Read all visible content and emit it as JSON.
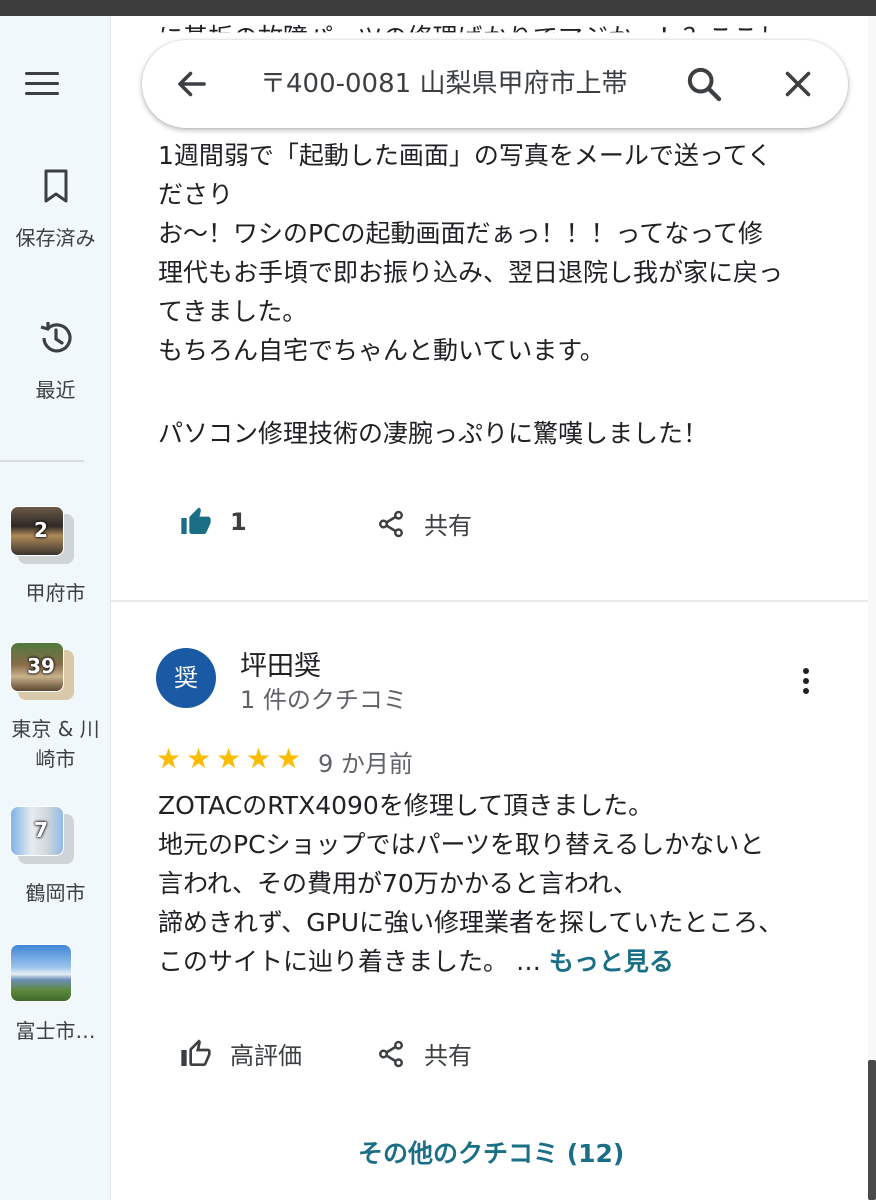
{
  "search": {
    "query": "〒400-0081 山梨県甲府市上帯"
  },
  "sidebar": {
    "saved_label": "保存済み",
    "recent_label": "最近",
    "places": [
      {
        "label": "甲府市",
        "count": "2"
      },
      {
        "label": "東京 & 川",
        "label2": "崎市",
        "count": "39"
      },
      {
        "label": "鶴岡市",
        "count": "7"
      },
      {
        "label": "富士市…",
        "count": ""
      }
    ]
  },
  "review1": {
    "partial_top": "に基板の故障パーツの修理ばかりでマジかっ！？ここし",
    "lines": [
      "1週間弱で「起動した画面」の写真をメールで送ってく",
      "ださり",
      "お～！ワシのPCの起動画面だぁっ！！！ってなって修",
      "理代もお手頃で即お振り込み、翌日退院し我が家に戻っ",
      "てきました。",
      "もちろん自宅でちゃんと動いています。",
      "",
      "パソコン修理技術の凄腕っぷりに驚嘆しました！"
    ],
    "like_count": "1",
    "share_label": "共有"
  },
  "review2": {
    "avatar_letter": "奨",
    "name": "坪田奨",
    "meta": "1 件のクチコミ",
    "rating": 5,
    "stars": "★★★★★",
    "date": "9 か月前",
    "lines": [
      "ZOTACのRTX4090を修理して頂きました。",
      "地元のPCショップではパーツを取り替えるしかないと",
      "言われ、その費用が70万かかると言われ、",
      "諦めきれず、GPUに強い修理業者を探していたところ、"
    ],
    "last_line": "このサイトに辿り着きました。 …",
    "more_label": "もっと見る",
    "like_label": "高評価",
    "share_label": "共有"
  },
  "footer": {
    "all_reviews_label": "その他のクチコミ (12)"
  },
  "colors": {
    "accent": "#1a6f87",
    "avatar_bg": "#1a5aa4",
    "star": "#fbbc04",
    "sidebar_bg": "#f1f8fb"
  }
}
